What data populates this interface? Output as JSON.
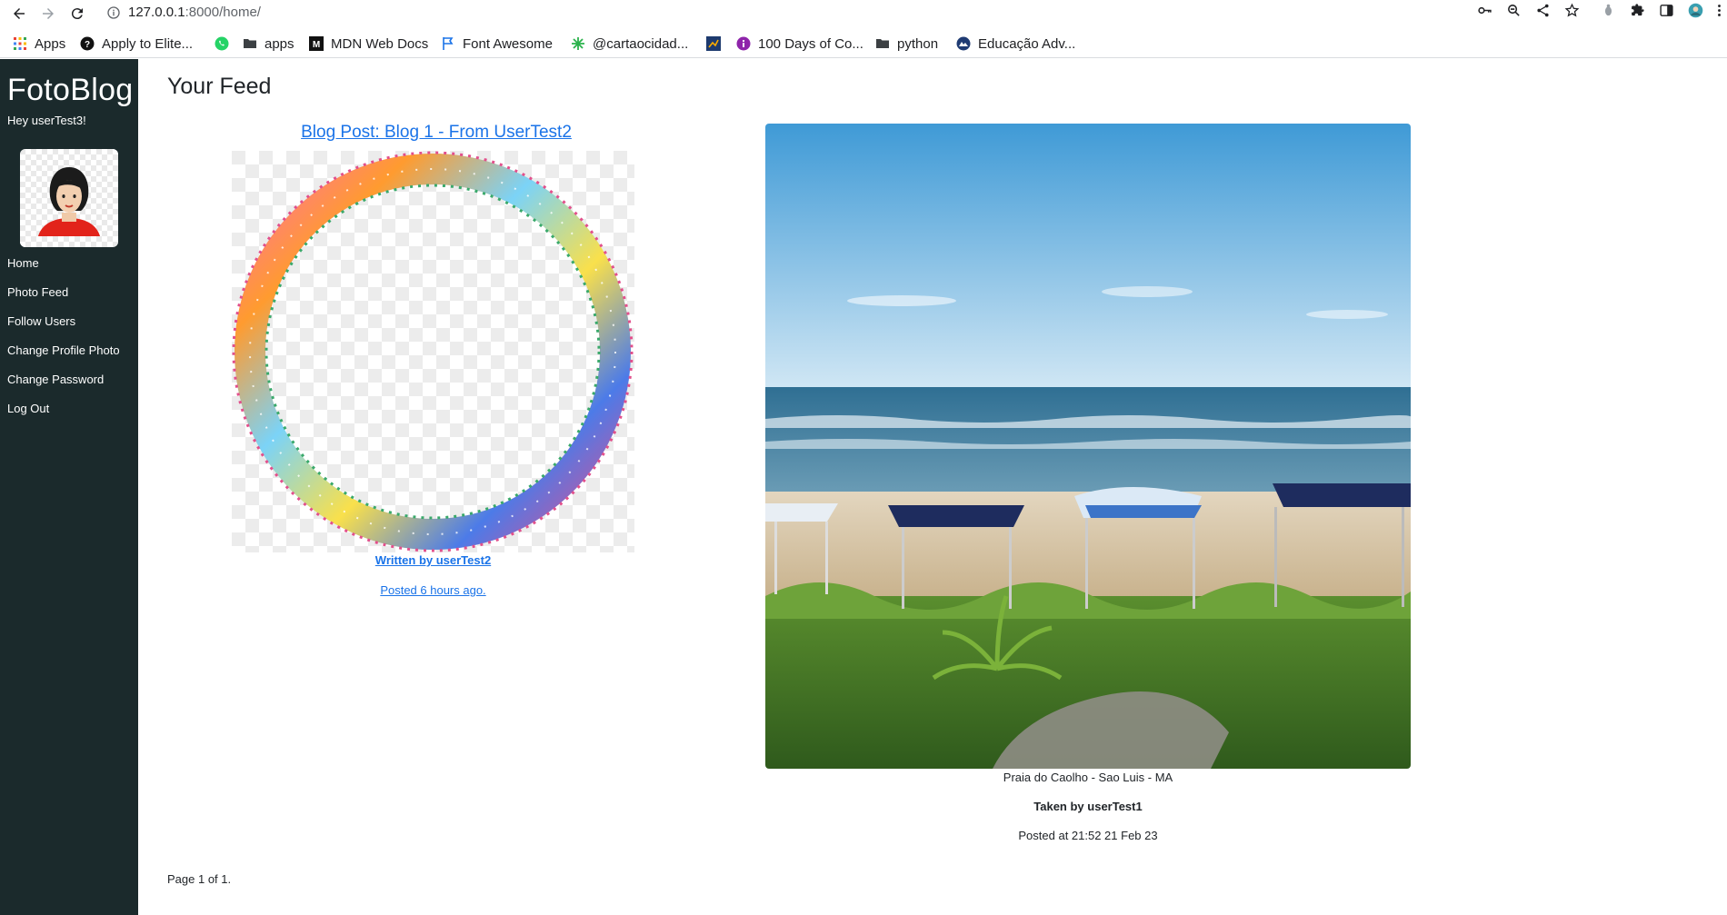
{
  "browser": {
    "url_host": "127.0.0.1",
    "url_path": ":8000/home/"
  },
  "bookmarks": [
    {
      "label": "Apps",
      "icon": "apps-grid-icon"
    },
    {
      "label": "Apply to Elite...",
      "icon": "elite-icon"
    },
    {
      "label": "",
      "icon": "whatsapp-icon"
    },
    {
      "label": "apps",
      "icon": "folder-icon"
    },
    {
      "label": "MDN Web Docs",
      "icon": "mdn-icon"
    },
    {
      "label": "Font Awesome",
      "icon": "flag-icon"
    },
    {
      "label": "@cartaocidad...",
      "icon": "leaf-icon"
    },
    {
      "label": "",
      "icon": "chart-icon"
    },
    {
      "label": "100 Days of Co...",
      "icon": "info-circle-icon"
    },
    {
      "label": "python",
      "icon": "folder-icon"
    },
    {
      "label": "Educação Adv...",
      "icon": "globe-icon"
    }
  ],
  "sidebar": {
    "brand": "FotoBlog",
    "greeting": "Hey userTest3!",
    "nav": [
      "Home",
      "Photo Feed",
      "Follow Users",
      "Change Profile Photo",
      "Change Password",
      "Log Out"
    ]
  },
  "main": {
    "title": "Your Feed",
    "blog_post": {
      "title": "Blog Post: Blog 1 - From UserTest2",
      "author": "Written by userTest2",
      "posted": "Posted 6 hours ago."
    },
    "photo": {
      "caption": "Praia do Caolho - Sao Luis - MA",
      "author": "Taken by userTest1",
      "posted": "Posted at 21:52 21 Feb 23"
    },
    "pagination": "Page 1 of 1."
  },
  "colors": {
    "sidebar_bg": "#1b2a2c",
    "link": "#1a73e8"
  }
}
